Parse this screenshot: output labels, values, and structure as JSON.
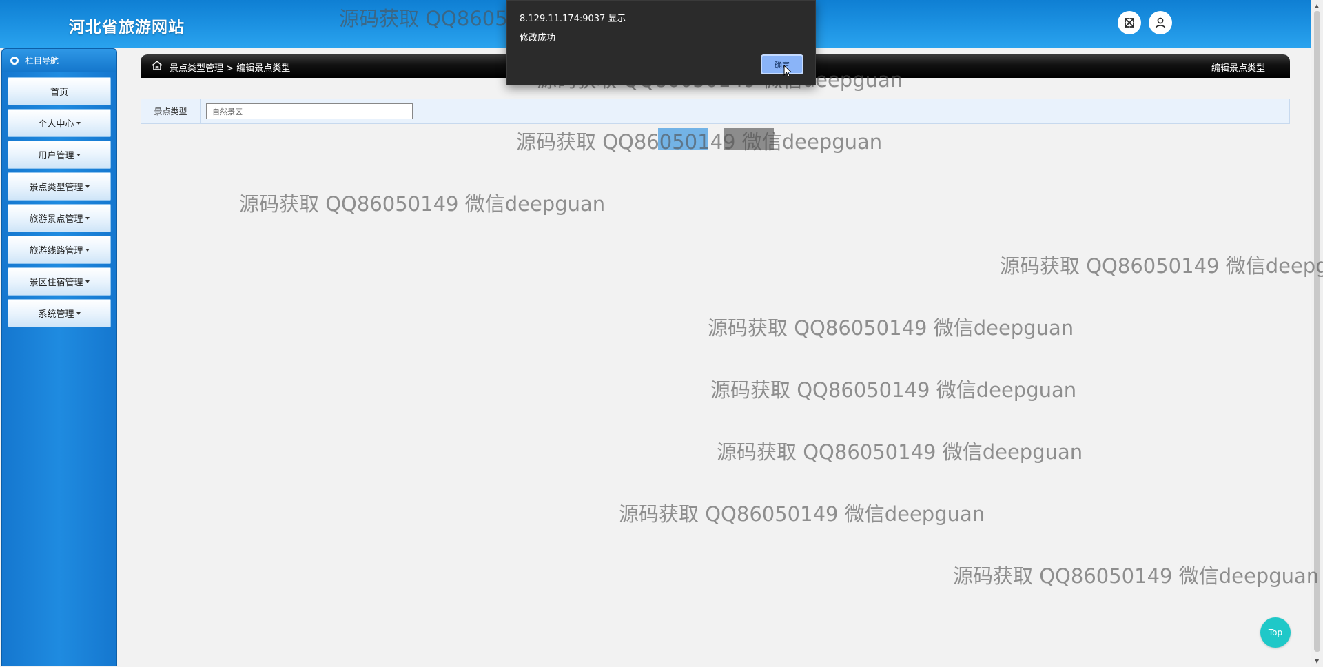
{
  "header": {
    "site_title": "河北省旅游网站",
    "expand_icon": "fullscreen-icon",
    "user_icon": "user-icon"
  },
  "sidebar": {
    "title": "栏目导航",
    "items": [
      {
        "label": "首页",
        "has_caret": false
      },
      {
        "label": "个人中心",
        "has_caret": true
      },
      {
        "label": "用户管理",
        "has_caret": true
      },
      {
        "label": "景点类型管理",
        "has_caret": true
      },
      {
        "label": "旅游景点管理",
        "has_caret": true
      },
      {
        "label": "旅游线路管理",
        "has_caret": true
      },
      {
        "label": "景区住宿管理",
        "has_caret": true
      },
      {
        "label": "系统管理",
        "has_caret": true
      }
    ]
  },
  "breadcrumb": {
    "parent": "景点类型管理",
    "separator": ">",
    "current": "编辑景点类型",
    "right_title": "编辑景点类型"
  },
  "form": {
    "field_label": "景点类型",
    "field_value": "自然景区"
  },
  "dialog": {
    "title": "8.129.11.174:9037 显示",
    "message": "修改成功",
    "ok_label": "确定"
  },
  "watermark": {
    "text": "源码获取 QQ86050149 微信deepguan"
  },
  "back_to_top": "Top",
  "colors": {
    "header_blue": "#1a8fe0",
    "sidebar_blue": "#1f8be0",
    "top_button": "#1fc8c8",
    "dialog_bg": "#2b2b2b"
  }
}
